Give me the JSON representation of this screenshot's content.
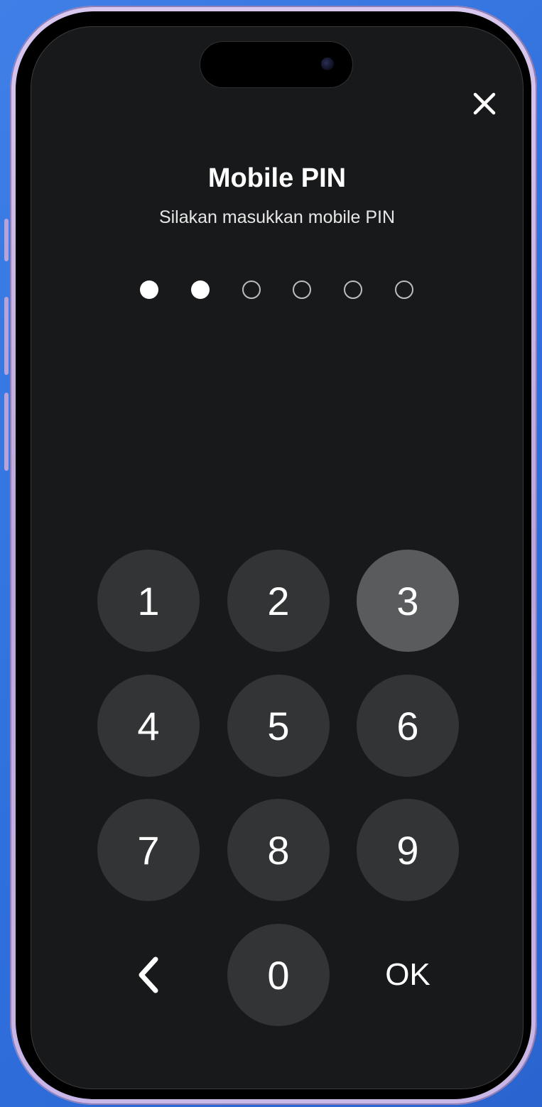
{
  "screen": {
    "title": "Mobile PIN",
    "subtitle": "Silakan masukkan mobile PIN"
  },
  "pin": {
    "length": 6,
    "entered": 2
  },
  "keypad": {
    "keys": [
      "1",
      "2",
      "3",
      "4",
      "5",
      "6",
      "7",
      "8",
      "9",
      "0"
    ],
    "pressed_key": "3",
    "ok_label": "OK"
  },
  "icons": {
    "close": "close-icon",
    "back": "chevron-left-icon"
  },
  "colors": {
    "background": "#18191a",
    "key": "#333435",
    "key_pressed": "#5a5b5c",
    "text": "#ffffff"
  }
}
